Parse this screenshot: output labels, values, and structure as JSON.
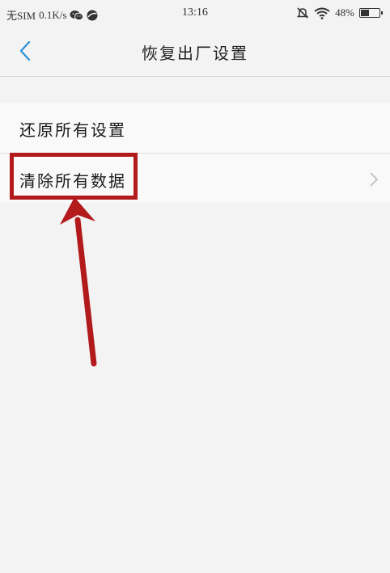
{
  "status_bar": {
    "carrier": "无SIM",
    "speed": "0.1K/s",
    "time": "13:16",
    "battery": "48%",
    "battery_level": 0.48,
    "icons": [
      "wechat-icon",
      "browser-icon",
      "mute-icon",
      "wifi-icon",
      "battery-icon"
    ]
  },
  "nav": {
    "title": "恢复出厂设置",
    "back_icon": "chevron-left-icon"
  },
  "list": {
    "items": [
      {
        "label": "还原所有设置"
      },
      {
        "label": "清除所有数据"
      }
    ]
  },
  "annotation": {
    "color": "#b21a1c"
  },
  "colors": {
    "accent": "#2a8fd6",
    "background": "#f3f3f3",
    "list_background": "#f9f9f9"
  }
}
